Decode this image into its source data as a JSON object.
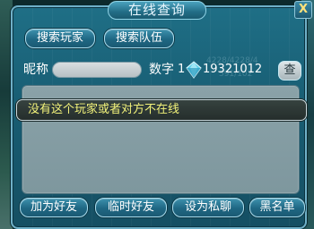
{
  "window": {
    "title": "在线查询",
    "close_label": "X"
  },
  "top_buttons": {
    "search_player": "搜索玩家",
    "search_team": "搜索队伍"
  },
  "query": {
    "nickname_label": "昵称",
    "nickname_value": "",
    "number_label": "数字",
    "number_prefix": "1",
    "number_value": "19321012",
    "search_button": "查"
  },
  "background_text": {
    "counter": "4228/4228/4",
    "sub": "591/102"
  },
  "result": {
    "message": "没有这个玩家或者对方不在线"
  },
  "bottom_buttons": {
    "add_friend": "加为好友",
    "temp_friend": "临时好友",
    "private_chat": "设为私聊",
    "blacklist": "黑名单"
  }
}
